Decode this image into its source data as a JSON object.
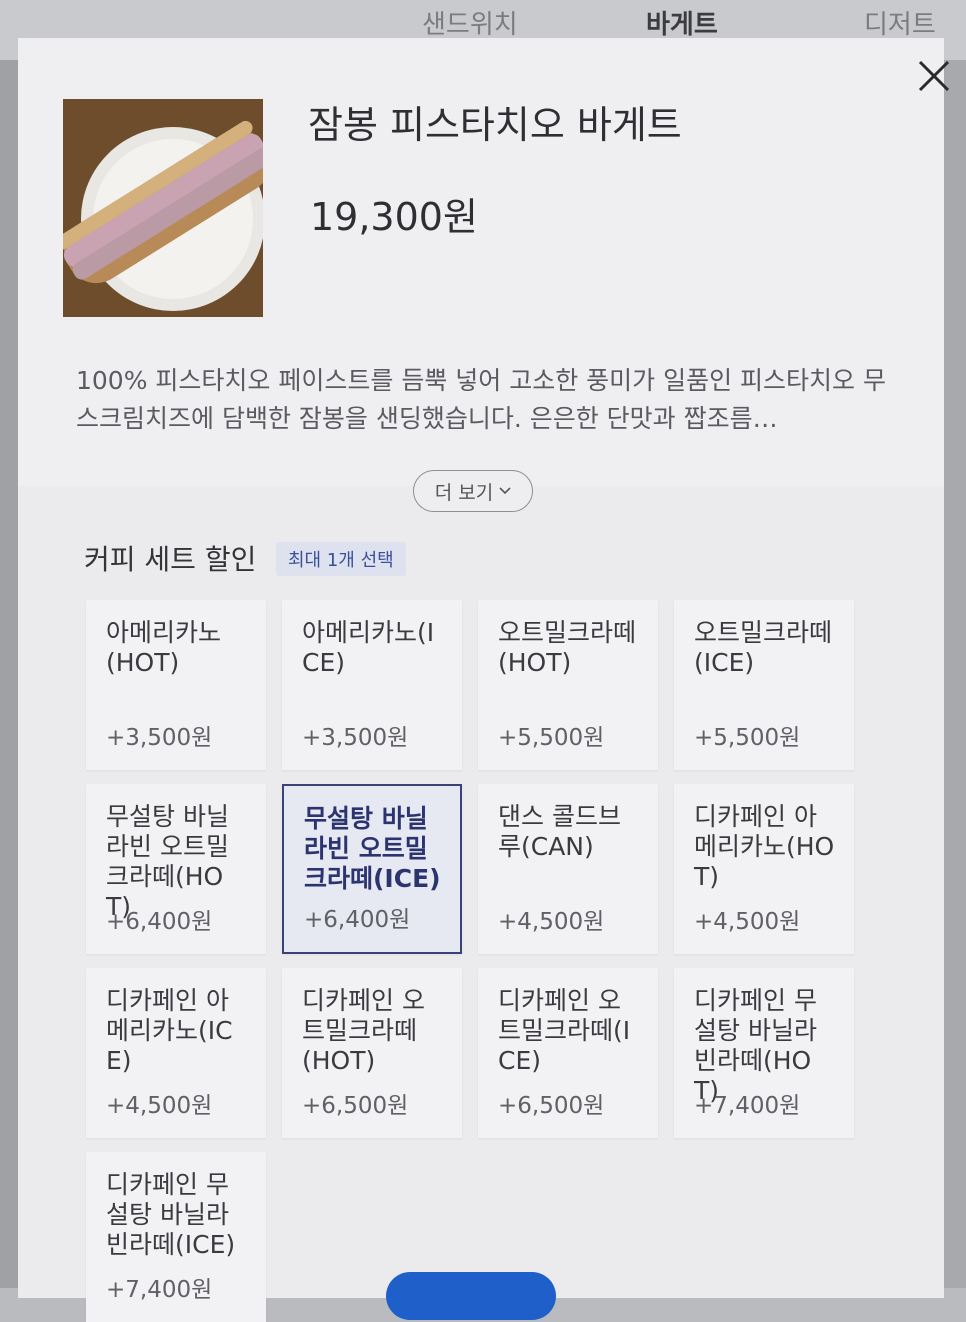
{
  "background_tabs": [
    "샌드위치",
    "바게트",
    "디저트"
  ],
  "product": {
    "name": "잠봉 피스타치오 바게트",
    "price": "19,300원",
    "description": "100% 피스타치오 페이스트를 듬뿍 넣어 고소한 풍미가 일품인 피스타치오 무스크림치즈에 담백한 잠봉을 샌딩했습니다. 은은한 단맛과 짭조름…",
    "more_label": "더 보기"
  },
  "option_group": {
    "title": "커피 세트 할인",
    "badge": "최대 1개 선택",
    "options": [
      {
        "name": "아메리카노(HOT)",
        "price": "+3,500원",
        "selected": false
      },
      {
        "name": "아메리카노(ICE)",
        "price": "+3,500원",
        "selected": false
      },
      {
        "name": "오트밀크라떼(HOT)",
        "price": "+5,500원",
        "selected": false
      },
      {
        "name": "오트밀크라떼(ICE)",
        "price": "+5,500원",
        "selected": false
      },
      {
        "name": "무설탕 바닐라빈 오트밀크라떼(HOT)",
        "price": "+6,400원",
        "selected": false
      },
      {
        "name": "무설탕 바닐라빈 오트밀크라떼(ICE)",
        "price": "+6,400원",
        "selected": true
      },
      {
        "name": "댄스 콜드브루(CAN)",
        "price": "+4,500원",
        "selected": false
      },
      {
        "name": "디카페인 아메리카노(HOT)",
        "price": "+4,500원",
        "selected": false
      },
      {
        "name": "디카페인 아메리카노(ICE)",
        "price": "+4,500원",
        "selected": false
      },
      {
        "name": "디카페인 오트밀크라떼(HOT)",
        "price": "+6,500원",
        "selected": false
      },
      {
        "name": "디카페인 오트밀크라떼(ICE)",
        "price": "+6,500원",
        "selected": false
      },
      {
        "name": "디카페인 무설탕 바닐라빈라떼(HOT)",
        "price": "+7,400원",
        "selected": false
      },
      {
        "name": "디카페인 무설탕 바닐라빈라떼(ICE)",
        "price": "+7,400원",
        "selected": false
      }
    ]
  },
  "colors": {
    "accent": "#39437a",
    "badge_text": "#3b4f9a",
    "primary_button": "#1f5fc9"
  }
}
